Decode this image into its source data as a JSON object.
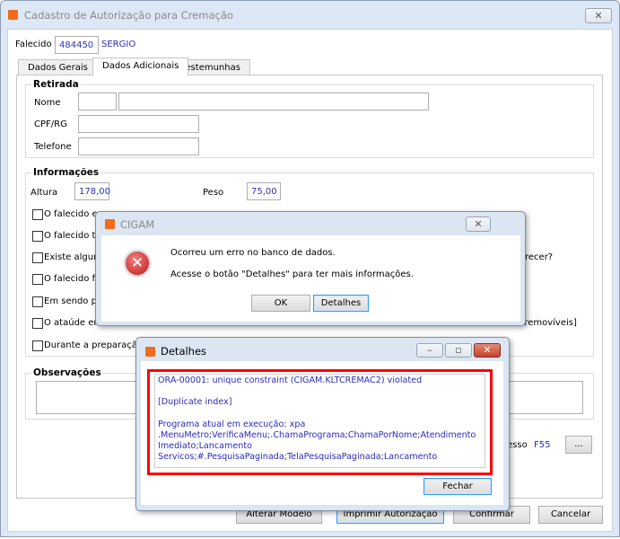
{
  "window": {
    "title": "Cadastro de Autorização para Cremação",
    "close_icon": "close-icon"
  },
  "falecido": {
    "label": "Falecido",
    "code": "484450",
    "name": "SERGIO"
  },
  "tabs": [
    {
      "label": "Dados Gerais"
    },
    {
      "label": "Dados Adicionais",
      "active": true
    },
    {
      "label": "Testemunhas"
    }
  ],
  "retirada": {
    "title": "Retirada",
    "nome_label": "Nome",
    "nome_code": "",
    "nome_value": "",
    "cpf_label": "CPF/RG",
    "cpf_value": "",
    "telefone_label": "Telefone",
    "telefone_value": ""
  },
  "informacoes": {
    "title": "Informações",
    "altura_label": "Altura",
    "altura_value": "178,00",
    "peso_label": "Peso",
    "peso_value": "75,00",
    "checkboxes": [
      {
        "label": "O falecido e"
      },
      {
        "label": "O falecido ti"
      },
      {
        "label": "Existe algum",
        "tail": "recer?"
      },
      {
        "label": "O falecido fo"
      },
      {
        "label": "Em sendo po"
      },
      {
        "label": "O ataúde em",
        "tail": "o removíveis]"
      },
      {
        "label": "Durante a preparação,"
      }
    ]
  },
  "observacoes": {
    "title": "Observações",
    "value": ""
  },
  "processo": {
    "label_partial": "esso",
    "value": "F55",
    "button": "..."
  },
  "buttons": {
    "alterar": "Alterar Modelo",
    "imprimir": "Imprimir Autorização",
    "confirmar": "Confirmar",
    "cancelar": "Cancelar"
  },
  "error_dialog": {
    "title": "CIGAM",
    "message": "Ocorreu um erro no banco de dados.",
    "hint": "Acesse o botão \"Detalhes\" para ter mais informações.",
    "ok": "OK",
    "details": "Detalhes",
    "icon": "error-icon"
  },
  "details_dialog": {
    "title": "Detalhes",
    "lines": [
      "ORA-00001: unique constraint (CIGAM.KLTCREMAC2) violated",
      "",
      "[Duplicate index]",
      "",
      "Programa atual em execução: xpa",
      ".MenuMetro;VerificaMenu;.ChamaPrograma;ChamaPorNome;Atendimento",
      "Imediato;Lancamento",
      "Servicos;#.PesquisaPaginada;TelaPesquisaPaginada;Lancamento"
    ],
    "close": "Fechar",
    "highlight_color": "#ff0000"
  }
}
